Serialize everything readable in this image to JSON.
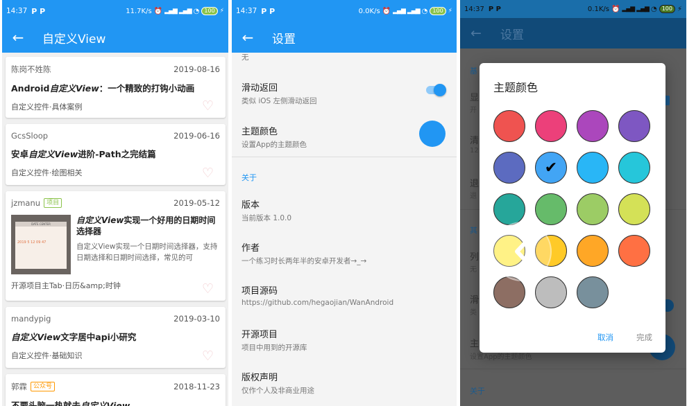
{
  "status": {
    "time": "14:37",
    "carrier_icons": "P P",
    "speed1": "11.7K/s",
    "speed2": "0.0K/s",
    "speed3": "0.1K/s",
    "battery": "100"
  },
  "screen1": {
    "title": "自定义View",
    "cards": [
      {
        "author": "陈岗不姓陈",
        "tag": "",
        "date": "2019-08-16",
        "title_bold": "Android",
        "title_italic": "自定义View",
        "title_rest": "：一个精致的打钩小动画",
        "category": "自定义控件·具体案例"
      },
      {
        "author": "GcsSloop",
        "tag": "",
        "date": "2019-06-16",
        "title_bold": "安卓",
        "title_italic": "自定义View",
        "title_rest": "进阶-Path之完结篇",
        "category": "自定义控件·绘图相关"
      },
      {
        "author": "jzmanu",
        "tag": "项目",
        "date": "2019-05-12",
        "title_italic": "自定义View",
        "title_rest": "实现一个好用的日期时间选择器",
        "desc": "自定义View实现一个日期时间选择器，支持日期选择和日期时间选择，常见的可",
        "category": "开源项目主Tab·日历&amp;时钟",
        "thumb_header": "DATE CENTER",
        "thumb_numbers": "2019 5 12 09 47"
      },
      {
        "author": "mandypig",
        "tag": "",
        "date": "2019-03-10",
        "title_italic": "自定义View",
        "title_rest": "文字居中api小研究",
        "category": "自定义控件·基础知识"
      },
      {
        "author": "郭霖",
        "tag": "公众号",
        "date": "2018-11-23",
        "title_bold": "不要头脑一热就去",
        "title_italic": "自定义View",
        "title_rest": ""
      }
    ]
  },
  "screen2": {
    "title": "设置",
    "top_cut": "无",
    "items": {
      "swipe": {
        "title": "滑动返回",
        "sub": "类似 iOS 左侧滑动返回"
      },
      "theme": {
        "title": "主题颜色",
        "sub": "设置App的主题颜色"
      },
      "about_header": "关于",
      "version": {
        "title": "版本",
        "sub": "当前版本 1.0.0"
      },
      "author": {
        "title": "作者",
        "sub": "一个练习时长两年半的安卓开发者→_→"
      },
      "source": {
        "title": "项目源码",
        "sub": "https://github.com/hegaojian/WanAndroid"
      },
      "opensource": {
        "title": "开源项目",
        "sub": "项目中用到的开源库"
      },
      "copyright": {
        "title": "版权声明",
        "sub": "仅作个人及非商业用途"
      }
    }
  },
  "screen3": {
    "title": "设置",
    "bg": {
      "header_basic": "基",
      "show": "显",
      "show_sub": "开",
      "clear": "清",
      "clear_sub": "12",
      "exit": "退",
      "exit_sub": "退",
      "header_other": "其",
      "list": "列",
      "list_sub": "无",
      "swipe": "滑",
      "swipe_sub": "类",
      "theme": "主",
      "theme_sub": "设置App的主题颜色",
      "about": "关于"
    },
    "dialog": {
      "title": "主题颜色",
      "cancel": "取消",
      "done": "完成",
      "selected_index": 5,
      "colors": [
        "#ef5350",
        "#ec407a",
        "#ab47bc",
        "#7e57c2",
        "#5c6bc0",
        "#42a5f5",
        "#29b6f6",
        "#26c6da",
        "#26a69a",
        "#66bb6a",
        "#9ccc65",
        "#d4e157",
        "#ffee58",
        "#ffca28",
        "#ffa726",
        "#ff7043",
        "#8d6e63",
        "#bdbdbd",
        "#78909c"
      ]
    }
  }
}
